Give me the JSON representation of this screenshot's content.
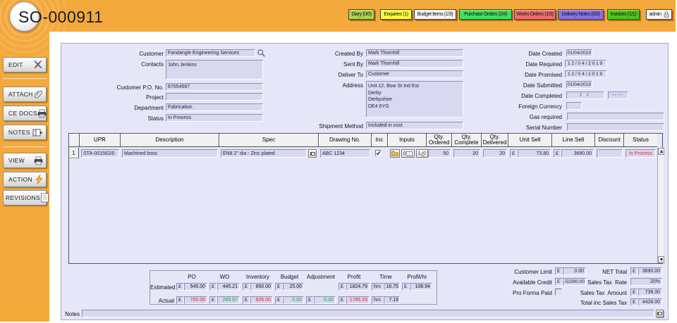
{
  "window": {
    "title": "SO-000911"
  },
  "topbar": {
    "buttons": [
      {
        "label": "Diary (0/0)",
        "color": "#A9D44B"
      },
      {
        "label": "Enquiries (1)",
        "color": "#FBFB3E"
      },
      {
        "label": "Budget Items (1/3)",
        "color": "#F2F2F2"
      },
      {
        "label": "Purchase Orders (2/4)",
        "color": "#40DE60"
      },
      {
        "label": "Works Orders (1/3)",
        "color": "#EF6F6F"
      },
      {
        "label": "Delivery Notes (0/3)",
        "color": "#8A70E6"
      },
      {
        "label": "Invoices (1/1)",
        "color": "#4EC717"
      }
    ],
    "user": {
      "label": "admin",
      "color": "#F4F4F4",
      "icon": "lock-icon"
    }
  },
  "sidebar": {
    "buttons": [
      {
        "label": "EDIT",
        "icon": "tools-icon"
      },
      {
        "label": "ATTACH",
        "icon": "paperclip-icon"
      },
      {
        "label": "CE DOCS",
        "icon": "printer-icon"
      },
      {
        "label": "NOTES",
        "icon": "notebook-icon"
      },
      {
        "label": "VIEW",
        "icon": "printer-icon"
      },
      {
        "label": "ACTION",
        "icon": "lightning-icon"
      },
      {
        "label": "REVISIONS",
        "icon": "document-icon"
      }
    ]
  },
  "form": {
    "customer": {
      "label": "Customer",
      "value": "Fandangle Engineering Services"
    },
    "contacts": {
      "label": "Contacts",
      "value": "John Jenkins"
    },
    "customer_po_no": {
      "label": "Customer P.O. No.",
      "value": "87654567"
    },
    "project": {
      "label": "Project",
      "value": ""
    },
    "department": {
      "label": "Department",
      "value": "Fabrication"
    },
    "status": {
      "label": "Status",
      "value": "In Process"
    },
    "created_by": {
      "label": "Created By",
      "value": "Mark Thornhill"
    },
    "sent_by": {
      "label": "Sent By",
      "value": "Mark Thornhill"
    },
    "deliver_to": {
      "label": "Deliver To",
      "value": "Customer"
    },
    "address": {
      "label": "Address",
      "value": "Unit 12, Bow St Ind Est\nDerby\nDerbyshire\nDE4 6YG"
    },
    "shipment_method": {
      "label": "Shipment Method",
      "value": "Included in cost"
    },
    "date_created": {
      "label": "Date Created",
      "value": "01/04/2019"
    },
    "date_required": {
      "label": "Date Required",
      "value": "12/04/2019"
    },
    "date_promised": {
      "label": "Date Promised",
      "value": "12/04/2019"
    },
    "date_submitted": {
      "label": "Date Submitted",
      "value": "01/04/2019"
    },
    "date_completed": {
      "label": "Date Completed",
      "value": "/    /",
      "time_value": "--:--"
    },
    "foreign_currency": {
      "label": "Foreign Currency",
      "value": ""
    },
    "gas_required": {
      "label": "Gas required",
      "value": ""
    },
    "serial_number": {
      "label": "Serial Number",
      "value": ""
    }
  },
  "items_table": {
    "columns": [
      "UPR",
      "Description",
      "Spec",
      "Drawing No.",
      "Inc",
      "Inputs",
      "Qty. Ordered",
      "Qty. Complete",
      "Qty. Delivered",
      "Unit Sell",
      "Line Sell",
      "Discount",
      "Status"
    ],
    "row": {
      "num": "1",
      "upr": "STA-001562/0",
      "description": "Machined boss",
      "spec": "EN8 2\" dia - Zinc plated",
      "drawing_no": "ABC 1234",
      "inc_checked": true,
      "inputs": {
        "docs_count": "0",
        "attach_count": "1"
      },
      "qty_ordered": "50",
      "qty_complete": "20",
      "qty_delivered": "20",
      "currency": "£",
      "unit_sell": "73.80",
      "line_sell": "3690.00",
      "discount": "",
      "status": "In Process",
      "status_color": "#CE3340"
    }
  },
  "summary": {
    "columns": [
      "PO",
      "WO",
      "Inventory",
      "Budget",
      "Adjustment",
      "Profit",
      "Time",
      "Profit/hr"
    ],
    "rows": [
      {
        "label": "Estimated",
        "po": {
          "cur": "£",
          "val": "545.00",
          "color": "#10101A"
        },
        "wo": {
          "cur": "£",
          "val": "445.21",
          "color": "#10101A"
        },
        "inventory": {
          "cur": "£",
          "val": "850.00",
          "color": "#10101A"
        },
        "budget": {
          "cur": "£",
          "val": "25.00",
          "color": "#10101A"
        },
        "adjustment": null,
        "profit": {
          "cur": "£",
          "val": "1824.79",
          "color": "#10101A"
        },
        "time": {
          "cur": "hrs",
          "val": "16.75",
          "color": "#10101A"
        },
        "profithr": {
          "cur": "£",
          "val": "108.94",
          "color": "#10101A"
        }
      },
      {
        "label": "Actual",
        "po": {
          "cur": "£",
          "val": "700.00",
          "color": "#E02222"
        },
        "wo": {
          "cur": "£",
          "val": "269.67",
          "color": "#1C9E3C"
        },
        "inventory": {
          "cur": "£",
          "val": "935.00",
          "color": "#E02222"
        },
        "budget": {
          "cur": "£",
          "val": "0.00",
          "color": "#1C9E3C"
        },
        "adjustment": {
          "cur": "£",
          "val": "0.00",
          "color": "#1C9E3C"
        },
        "profit": {
          "cur": "£",
          "val": "1785.33",
          "color": "#E02222"
        },
        "time": {
          "cur": "hrs",
          "val": "7.19",
          "color": "#10101A"
        },
        "profithr": null
      }
    ]
  },
  "totals": {
    "customer_limit": {
      "label": "Customer Limit",
      "cur": "£",
      "value": "0.00"
    },
    "available_credit": {
      "label": "Available Credit",
      "cur": "£",
      "value": "-52390.00"
    },
    "pro_forma_paid": {
      "label": "Pro Forma Paid",
      "checked": false
    },
    "net_total": {
      "label": "NET Total",
      "cur": "£",
      "value": "3690.00"
    },
    "sales_tax_rate": {
      "label": "Sales Tax  Rate",
      "value": "20%"
    },
    "sales_tax_amount": {
      "label": "Sales Tax  Amount",
      "cur": "£",
      "value": "738.00"
    },
    "total_inc": {
      "label": "Total inc Sales Tax",
      "cur": "£",
      "value": "4428.00"
    }
  },
  "notes": {
    "label": "Notes",
    "value": ""
  }
}
